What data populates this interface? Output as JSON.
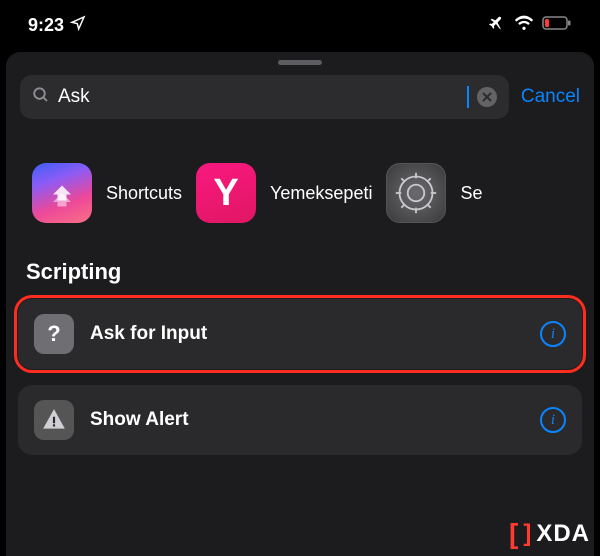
{
  "status": {
    "time": "9:23"
  },
  "search": {
    "value": "Ask",
    "cancel": "Cancel"
  },
  "apps": [
    {
      "label": "Shortcuts"
    },
    {
      "label": "Yemeksepeti"
    },
    {
      "label": "Se"
    }
  ],
  "section": {
    "title": "Scripting"
  },
  "actions": [
    {
      "label": "Ask for Input",
      "icon": "?"
    },
    {
      "label": "Show Alert",
      "icon": "!"
    }
  ],
  "watermark": "XDA"
}
